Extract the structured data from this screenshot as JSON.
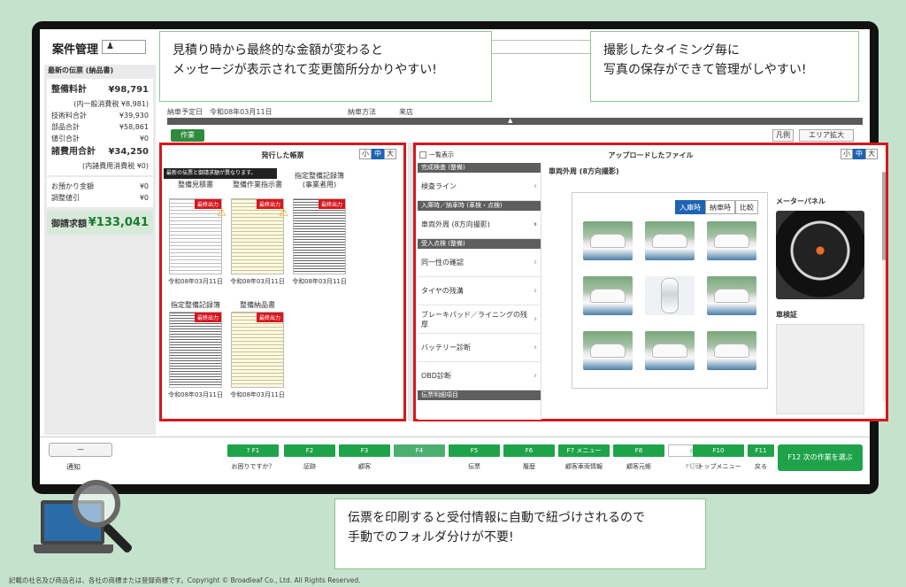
{
  "screen": {
    "title": "案件管理",
    "user_icon": "user-icon"
  },
  "left_panel": {
    "header": "最新の伝票 (納品書)",
    "maintenance_total_label": "整備料計",
    "maintenance_total_value": "¥98,791",
    "maintenance_tax_note": "(内一般消費税 ¥8,981)",
    "rows": [
      {
        "label": "技術料合計",
        "value": "¥39,930"
      },
      {
        "label": "部品合計",
        "value": "¥58,861"
      },
      {
        "label": "値引合計",
        "value": "¥0"
      }
    ],
    "misc_total_label": "諸費用合計",
    "misc_total_value": "¥34,250",
    "misc_tax_note": "(内諸費用消費税 ¥0)",
    "rows2": [
      {
        "label": "お預かり金額",
        "value": "¥0"
      },
      {
        "label": "調整値引",
        "value": "¥0"
      }
    ],
    "billing_label": "御請求額",
    "billing_value": "¥133,041",
    "collapse": "«"
  },
  "main": {
    "info_due_label": "納車予定日",
    "info_due_value": "令和08年03月11日",
    "info_method_label": "納車方法",
    "info_method_value": "来店",
    "strip_arrow": "▲",
    "tab_green": "作業",
    "legend_button": "凡例",
    "expand_button": "エリア拡大"
  },
  "vouchers": {
    "title": "発行した帳票",
    "sizes": [
      "小",
      "中",
      "大"
    ],
    "tooltip": "最新の伝票と御請求額が異なります。",
    "docs": [
      {
        "name": "整備見積書",
        "badge": "最終出力",
        "date": "令和08年03月11日"
      },
      {
        "name": "整備作業指示書",
        "badge": "最終出力",
        "date": "令和08年03月11日"
      },
      {
        "name": "指定整備記録簿 (事業者用)",
        "badge": "最終出力",
        "date": "令和08年03月11日"
      },
      {
        "name": "指定整備記録簿",
        "badge": "最終出力",
        "date": "令和08年03月11日"
      },
      {
        "name": "整備納品書",
        "badge": "最終出力",
        "date": "令和08年03月11日"
      }
    ]
  },
  "uploads": {
    "title": "アップロードしたファイル",
    "show_all": "一覧表示",
    "sizes": [
      "小",
      "中",
      "大"
    ],
    "sections": [
      {
        "head": "完成検査 (整備)",
        "items": [
          "検査ライン"
        ]
      },
      {
        "head": "入庫時／納車時 (車検・点検)",
        "items": [
          "車両外周 (8方向撮影)"
        ]
      },
      {
        "head": "受入点検 (整備)",
        "items": [
          "同一性の確認",
          "タイヤの残溝",
          "ブレーキパッド／ライニングの残厚",
          "バッテリー診断",
          "OBD診断"
        ]
      },
      {
        "head": "伝票明細項目",
        "items": []
      }
    ],
    "photos_head": "車両外周 (8方向撮影)",
    "segments": [
      "入庫時",
      "納車時",
      "比較"
    ],
    "meter_label": "メーターパネル",
    "cert_label": "車検証"
  },
  "fkeys": {
    "notify_button": "—",
    "notify_label": "通知",
    "keys": [
      {
        "key": "? F1",
        "label": "お困りですか？"
      },
      {
        "key": "F2",
        "label": "証跡"
      },
      {
        "key": "F3",
        "label": "顧客"
      },
      {
        "key": "F4",
        "label": ""
      },
      {
        "key": "F5",
        "label": "伝票"
      },
      {
        "key": "F6",
        "label": "履歴"
      },
      {
        "key": "F7 メニュー",
        "label": "顧客車両情報"
      },
      {
        "key": "F8",
        "label": "顧客元帳"
      },
      {
        "key": "F9",
        "label": "F切替"
      },
      {
        "key": "F10",
        "label": "トップメニュー"
      },
      {
        "key": "F11",
        "label": "戻る"
      }
    ],
    "f12": "F12 次の作業を選ぶ"
  },
  "callouts": {
    "c1_line1": "見積り時から最終的な金額が変わると",
    "c1_line2": "メッセージが表示されて変更箇所分かりやすい!",
    "c2_line1": "撮影したタイミング毎に",
    "c2_line2": "写真の保存ができて管理がしやすい!",
    "c3_line1": "伝票を印刷すると受付情報に自動で紐づけされるので",
    "c3_line2": "手動でのフォルダ分けが不要!"
  },
  "footer": "記載の社名及び商品名は、各社の商標または登録商標です。Copyright © Broadleaf Co., Ltd. All Rights Reserved.",
  "colors": {
    "accent_green": "#1fa34a",
    "highlight_red": "#d8161c",
    "selected_blue": "#1e63b4",
    "background": "#c5e2cc"
  }
}
